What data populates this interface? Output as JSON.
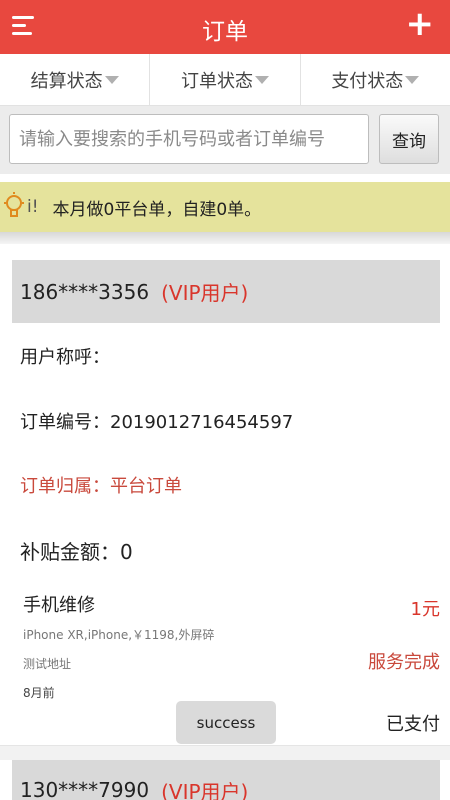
{
  "header": {
    "title": "订单",
    "add_label": "+"
  },
  "filters": [
    {
      "label": "结算状态"
    },
    {
      "label": "订单状态"
    },
    {
      "label": "支付状态"
    }
  ],
  "search": {
    "placeholder": "请输入要搜索的手机号码或者订单编号",
    "button_label": "查询"
  },
  "notice": {
    "fragment": "i!",
    "message": "本月做0平台单，自建0单。"
  },
  "orders": [
    {
      "phone": "186****3356",
      "vip": "(VIP用户)",
      "user_name": "用户称呼：",
      "order_no": "订单编号：2019012716454597",
      "ownership": "订单归属：平台订单",
      "subsidy": "补贴金额：0",
      "service_name": "手机维修",
      "service_desc": "iPhone XR,iPhone,￥1198,外屏碎",
      "address": "测试地址",
      "time": "8月前",
      "price": "1元",
      "service_status": "服务完成",
      "pay_status": "已支付"
    },
    {
      "phone": "130****7990",
      "vip": "(VIP用户)"
    }
  ],
  "toast": {
    "text": "success"
  },
  "colors": {
    "brand": "#e8483f",
    "vip_red": "#d9352b",
    "notice_bg": "#e5e39c"
  }
}
